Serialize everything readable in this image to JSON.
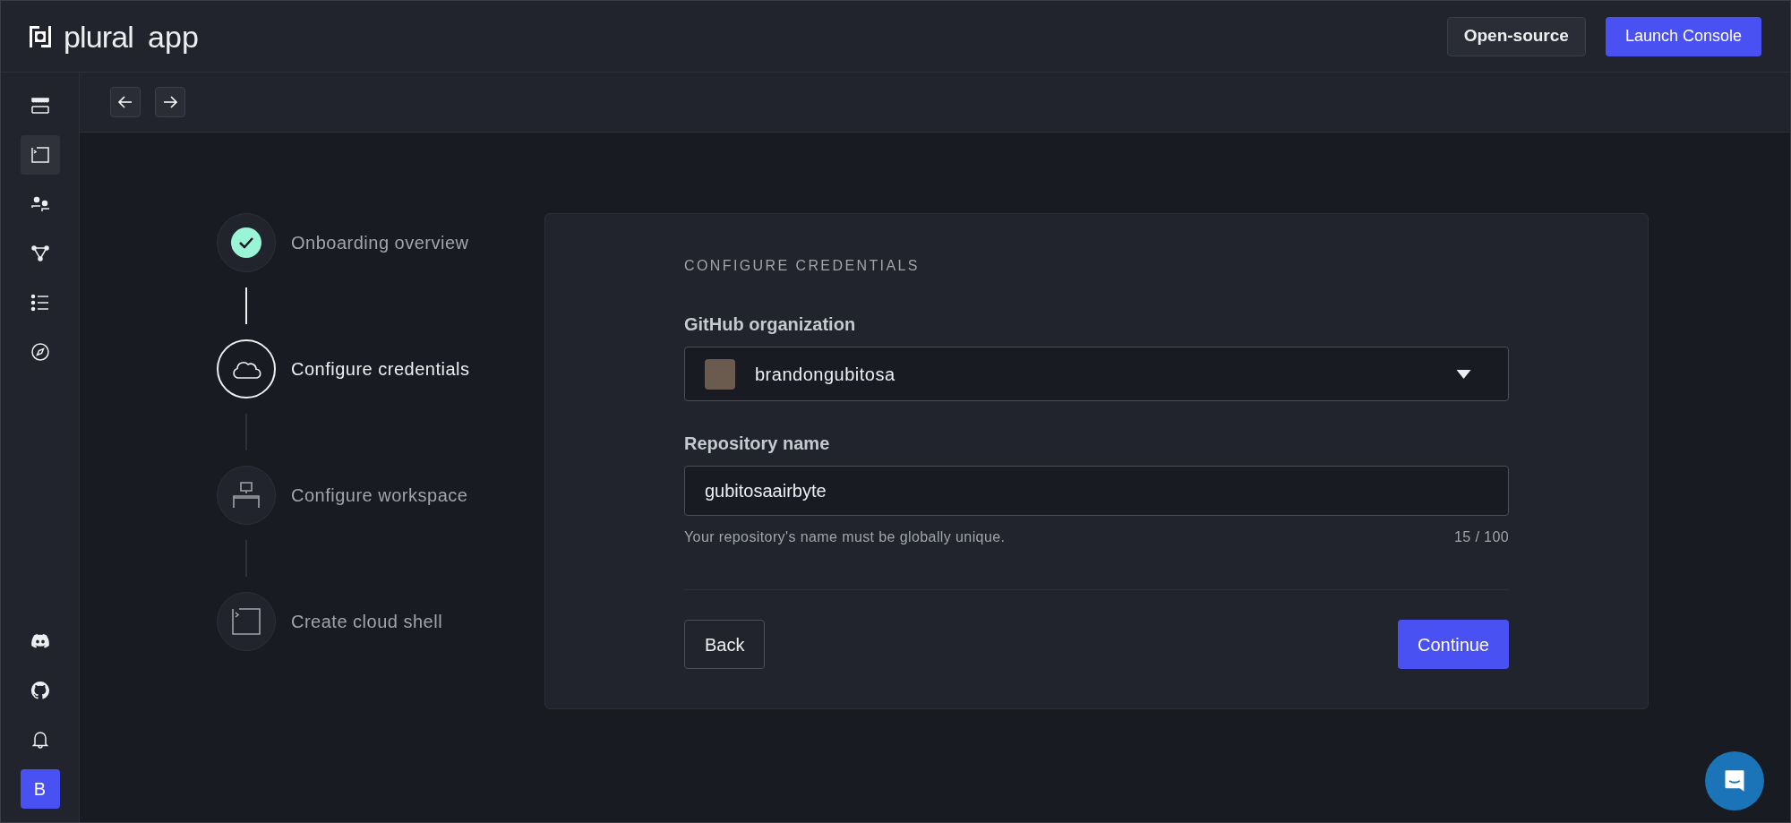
{
  "header": {
    "logo_text": "plural",
    "app_label": "app",
    "buttons": [
      {
        "label": "Open-source",
        "kind": "secondary"
      },
      {
        "label": "Launch Console",
        "kind": "primary"
      }
    ]
  },
  "sidebar": {
    "items": [
      {
        "kind": "marketplace",
        "selected": false
      },
      {
        "kind": "terminal",
        "selected": true
      },
      {
        "kind": "users",
        "selected": false
      },
      {
        "kind": "graph",
        "selected": false
      },
      {
        "kind": "list",
        "selected": false
      },
      {
        "kind": "compass",
        "selected": false
      }
    ],
    "bottom_items": [
      {
        "kind": "discord"
      },
      {
        "kind": "github"
      },
      {
        "kind": "bell"
      }
    ],
    "avatar": "B"
  },
  "steps": [
    {
      "label": "Onboarding overview",
      "completed": true,
      "selected": false
    },
    {
      "label": "Configure credentials",
      "completed": false,
      "selected": true,
      "kind": "cloud"
    },
    {
      "label": "Configure workspace",
      "completed": false,
      "selected": false,
      "kind": "desk"
    },
    {
      "label": "Create cloud shell",
      "completed": false,
      "selected": false,
      "kind": "terminal"
    }
  ],
  "form": {
    "heading": "CONFIGURE CREDENTIALS",
    "org_label": "GitHub organization",
    "org_value": "brandongubitosa",
    "repo_label": "Repository name",
    "repo_value": "gubitosaairbyte",
    "repo_hint": "Your repository's name must be globally unique.",
    "repo_count": "15 / 100",
    "back": "Back",
    "continue": "Continue"
  }
}
